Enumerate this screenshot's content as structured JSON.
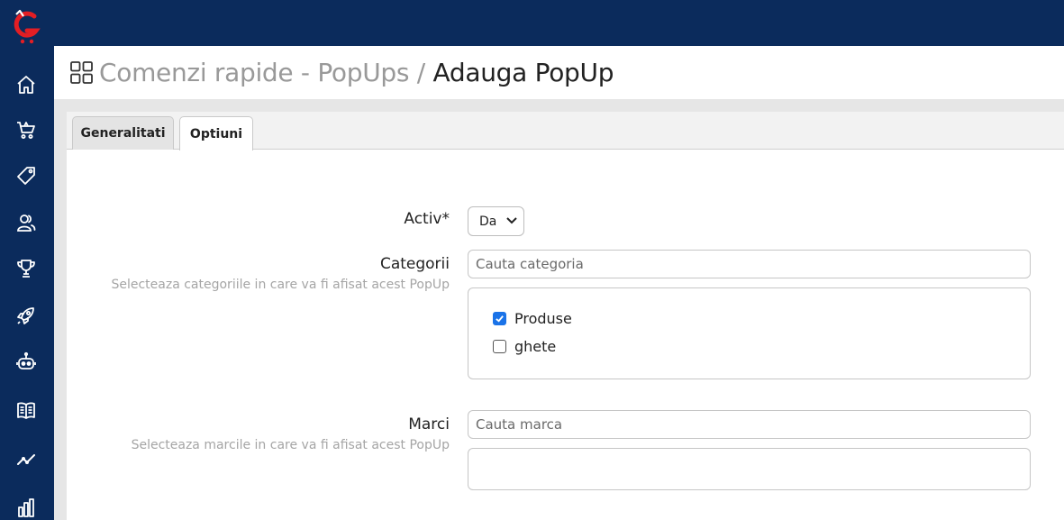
{
  "sidebar": {
    "logo_icon": "g-cart-logo",
    "items": [
      {
        "icon": "home-icon"
      },
      {
        "icon": "cart-icon"
      },
      {
        "icon": "tag-icon"
      },
      {
        "icon": "users-icon"
      },
      {
        "icon": "trophy-icon"
      },
      {
        "icon": "rocket-icon"
      },
      {
        "icon": "robot-icon"
      },
      {
        "icon": "book-icon"
      },
      {
        "icon": "trend-icon"
      },
      {
        "icon": "bar-chart-icon"
      }
    ]
  },
  "header": {
    "breadcrumb_parent": "Comenzi rapide - PopUps",
    "separator": " / ",
    "current": "Adauga PopUp"
  },
  "tabs": [
    {
      "label": "Generalitati",
      "active": false
    },
    {
      "label": "Optiuni",
      "active": true
    }
  ],
  "form": {
    "activ": {
      "label": "Activ*",
      "value": "Da"
    },
    "categorii": {
      "label": "Categorii",
      "help": "Selecteaza categoriile in care va fi afisat acest PopUp",
      "search_placeholder": "Cauta categoria",
      "options": [
        {
          "label": "Produse",
          "checked": true
        },
        {
          "label": "ghete",
          "checked": false
        }
      ]
    },
    "marci": {
      "label": "Marci",
      "help": "Selecteaza marcile in care va fi afisat acest PopUp",
      "search_placeholder": "Cauta marca"
    }
  },
  "colors": {
    "brand_navy": "#0b2b5c",
    "logo_red": "#e31e24",
    "checkbox_blue": "#1a73e8"
  }
}
